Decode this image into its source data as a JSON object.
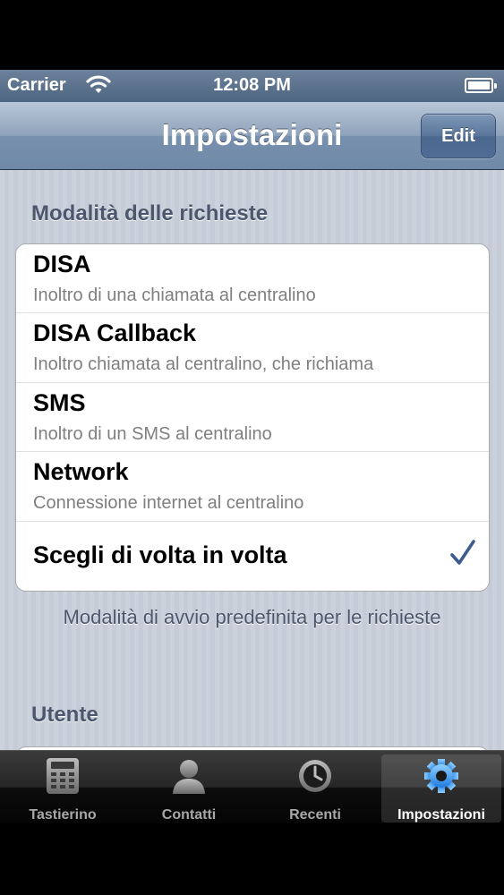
{
  "status_bar": {
    "carrier": "Carrier",
    "time": "12:08 PM",
    "icons": [
      "wifi-icon",
      "battery-icon"
    ]
  },
  "nav_bar": {
    "title": "Impostazioni",
    "edit_label": "Edit"
  },
  "sections": {
    "request_mode": {
      "header": "Modalità delle richieste",
      "items": [
        {
          "title": "DISA",
          "subtitle": "Inoltro di una chiamata al centralino"
        },
        {
          "title": "DISA Callback",
          "subtitle": "Inoltro chiamata al centralino, che richiama"
        },
        {
          "title": "SMS",
          "subtitle": "Inoltro di un SMS al centralino"
        },
        {
          "title": "Network",
          "subtitle": "Connessione internet al centralino"
        },
        {
          "title": "Scegli di volta in volta",
          "selected": true
        }
      ],
      "footer": "Modalità di avvio predefinita per le richieste"
    },
    "user": {
      "header": "Utente"
    }
  },
  "tab_bar": {
    "tabs": [
      {
        "label": "Tastierino",
        "icon": "keypad-icon"
      },
      {
        "label": "Contatti",
        "icon": "contacts-icon"
      },
      {
        "label": "Recenti",
        "icon": "clock-icon"
      },
      {
        "label": "Impostazioni",
        "icon": "gear-icon",
        "selected": true
      }
    ]
  },
  "colors": {
    "accent_blue": "#3872d6",
    "header_text": "#4c566c",
    "checkmark": "#3d5b8f"
  }
}
